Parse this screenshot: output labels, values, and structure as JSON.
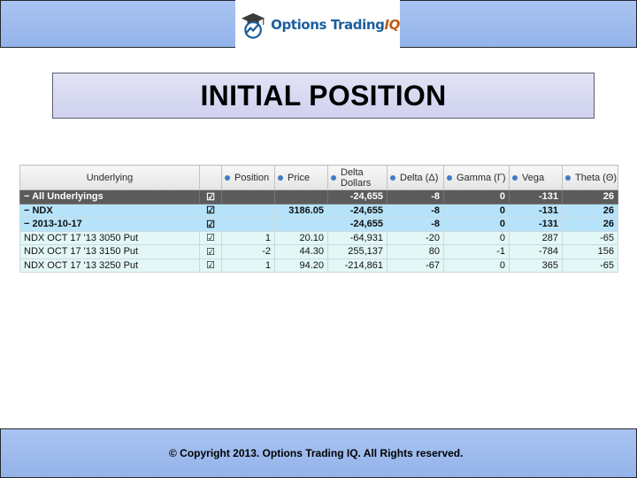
{
  "brand": {
    "logo_text": "Options Trading",
    "logo_text_accent": "IQ",
    "icon": "graduation-cap-chart-icon"
  },
  "title": "INITIAL POSITION",
  "table": {
    "columns": [
      {
        "label": "Underlying",
        "has_dot": false
      },
      {
        "label": "",
        "has_dot": false
      },
      {
        "label": "Position",
        "has_dot": true
      },
      {
        "label": "Price",
        "has_dot": true
      },
      {
        "label": "Delta Dollars",
        "has_dot": true
      },
      {
        "label": "Delta (Δ)",
        "has_dot": true
      },
      {
        "label": "Gamma (Γ)",
        "has_dot": true
      },
      {
        "label": "Vega",
        "has_dot": true
      },
      {
        "label": "Theta (Θ)",
        "has_dot": true
      }
    ],
    "rows": [
      {
        "level": 0,
        "kind": "group",
        "name": "All Underlyings",
        "checked": "☑",
        "position": "",
        "price": "",
        "delta_dollars": "-24,655",
        "delta": "-8",
        "gamma": "0",
        "vega": "-131",
        "theta": "26"
      },
      {
        "level": 1,
        "kind": "group",
        "name": "NDX",
        "checked": "☑",
        "position": "",
        "price": "3186.05",
        "delta_dollars": "-24,655",
        "delta": "-8",
        "gamma": "0",
        "vega": "-131",
        "theta": "26"
      },
      {
        "level": 2,
        "kind": "group",
        "name": "2013-10-17",
        "checked": "☑",
        "position": "",
        "price": "",
        "delta_dollars": "-24,655",
        "delta": "-8",
        "gamma": "0",
        "vega": "-131",
        "theta": "26"
      },
      {
        "level": 3,
        "kind": "leg",
        "name": "NDX OCT 17 '13 3050 Put",
        "checked": "☑",
        "position": "1",
        "price": "20.10",
        "delta_dollars": "-64,931",
        "delta": "-20",
        "gamma": "0",
        "vega": "287",
        "theta": "-65"
      },
      {
        "level": 3,
        "kind": "leg",
        "name": "NDX OCT 17 '13 3150 Put",
        "checked": "☑",
        "position": "-2",
        "price": "44.30",
        "delta_dollars": "255,137",
        "delta": "80",
        "gamma": "-1",
        "vega": "-784",
        "theta": "156"
      },
      {
        "level": 3,
        "kind": "leg",
        "name": "NDX OCT 17 '13 3250 Put",
        "checked": "☑",
        "position": "1",
        "price": "94.20",
        "delta_dollars": "-214,861",
        "delta": "-67",
        "gamma": "0",
        "vega": "365",
        "theta": "-65"
      }
    ]
  },
  "footer": {
    "copyright": "© Copyright 2013. Options Trading IQ. All Rights reserved."
  },
  "colors": {
    "bar_blue": "#a9c4f2",
    "banner_lavender": "#d8d9f2",
    "total_row": "#5b5b5b",
    "group_row": "#b6e3fa",
    "leg_row": "#e3f7f6",
    "logo_blue": "#1c5e9c",
    "logo_orange": "#c05d16"
  }
}
